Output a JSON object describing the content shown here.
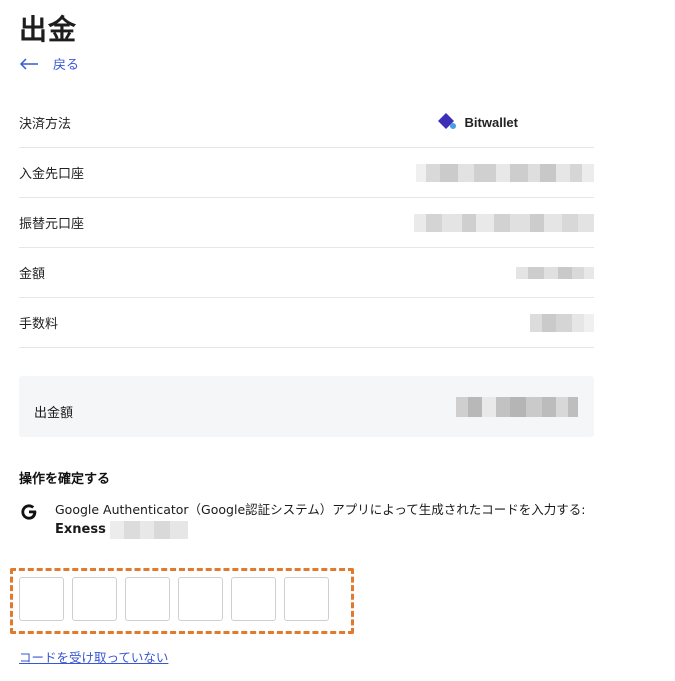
{
  "page": {
    "title": "出金",
    "back_label": "戻る"
  },
  "details": {
    "rows": [
      {
        "label": "決済方法",
        "value": "Bitwallet"
      },
      {
        "label": "入金先口座",
        "value": ""
      },
      {
        "label": "振替元口座",
        "value": ""
      },
      {
        "label": "金額",
        "value": ""
      },
      {
        "label": "手数料",
        "value": ""
      }
    ]
  },
  "summary": {
    "label": "出金額"
  },
  "confirm": {
    "title": "操作を確定する",
    "instruction": "Google Authenticator（Google認証システム）アプリによって生成されたコードを入力する:",
    "account_prefix": "Exness"
  },
  "otp": {
    "digits": [
      "",
      "",
      "",
      "",
      "",
      ""
    ]
  },
  "resend_label": "コードを受け取っていない",
  "colors": {
    "accent": "#3a56d4",
    "highlight": "#e07a2e",
    "wallet_brand": "#3d2fb8"
  },
  "icons": {
    "back": "arrow-left-icon",
    "wallet": "bitwallet-logo-icon",
    "google": "google-g-icon"
  }
}
